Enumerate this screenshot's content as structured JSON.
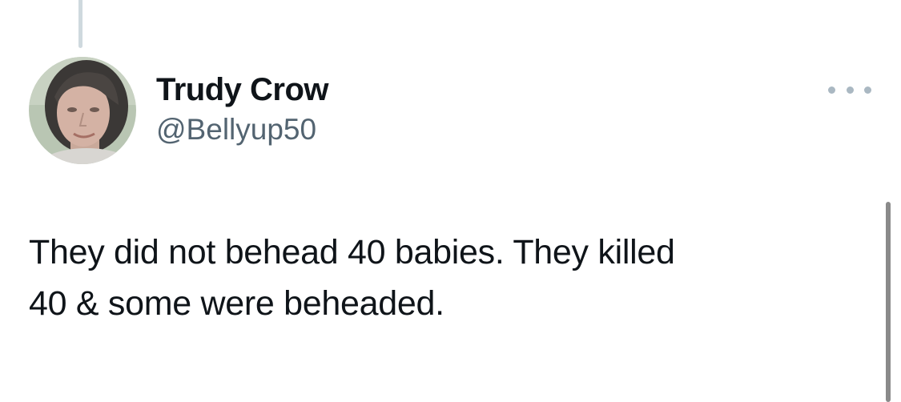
{
  "tweet": {
    "author": {
      "display_name": "Trudy Crow",
      "handle": "@Bellyup50",
      "avatar_icon": "avatar-photo"
    },
    "more_icon": "more-horizontal-icon",
    "text": "They did not behead 40 babies. They killed\n40 & some were beheaded."
  },
  "colors": {
    "text_primary": "#0f1419",
    "text_secondary": "#536471",
    "thread_line": "#cfd9de"
  }
}
